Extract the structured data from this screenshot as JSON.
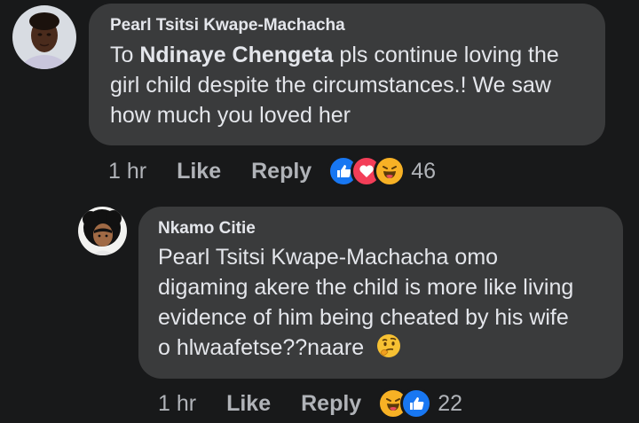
{
  "comment": {
    "author": "Pearl Tsitsi Kwape-Machacha",
    "mention": "Ndinaye Chengeta",
    "text_prefix": "To",
    "text_line1_rest": "pls continue loving the",
    "text_line2": "girl child despite the circumstances.! We saw",
    "text_line3": "how much you loved her",
    "time": "1 hr",
    "like_label": "Like",
    "reply_label": "Reply",
    "reaction_icons": [
      "like-icon",
      "love-icon",
      "haha-icon"
    ],
    "reaction_count": "46"
  },
  "reply": {
    "author": "Nkamo Citie",
    "text_line1": "Pearl Tsitsi Kwape-Machacha omo",
    "text_line2": "digaming akere the child is more like living",
    "text_line3": "evidence of him being cheated by his wife",
    "text_line4": "o hlwaafetse??naare",
    "emoji_icon": "thinking-face-icon",
    "time": "1 hr",
    "like_label": "Like",
    "reply_label": "Reply",
    "reaction_icons": [
      "haha-icon",
      "like-icon"
    ],
    "reaction_count": "22"
  },
  "colors": {
    "background": "#18191a",
    "bubble": "#3a3b3c",
    "text": "#e4e6eb",
    "muted": "#b0b3b8",
    "like_blue": "#1877f2",
    "love_red": "#f33e58",
    "haha_yellow": "#f7b125"
  }
}
